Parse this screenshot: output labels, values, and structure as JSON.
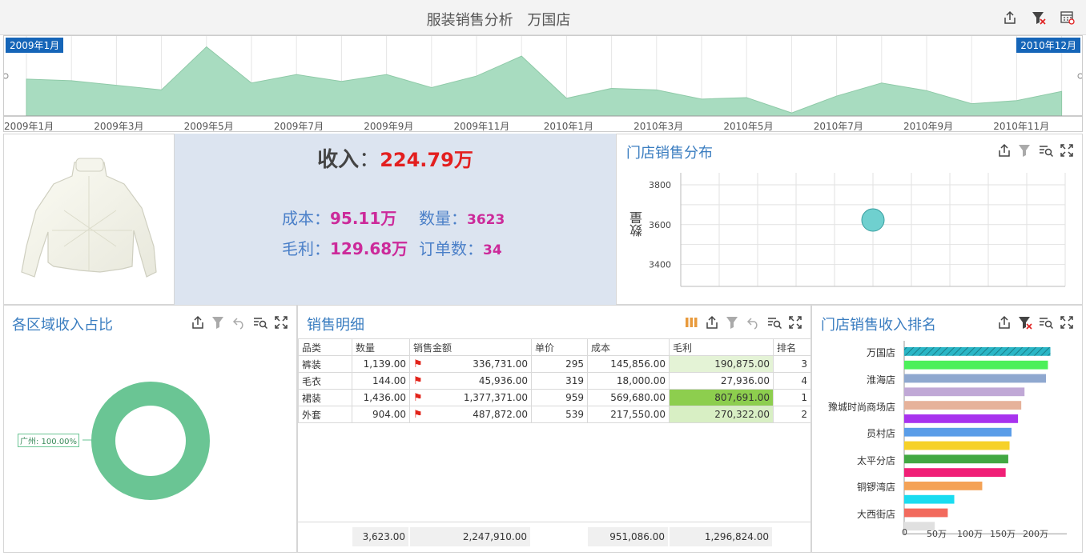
{
  "header": {
    "title": "服装销售分析",
    "store": "万国店"
  },
  "timeline": {
    "start_badge": "2009年1月",
    "end_badge": "2010年12月",
    "labels": [
      "2009年1月",
      "2009年3月",
      "2009年5月",
      "2009年7月",
      "2009年9月",
      "2009年11月",
      "2010年1月",
      "2010年3月",
      "2010年5月",
      "2010年7月",
      "2010年9月",
      "2010年11月"
    ],
    "color": "#a8dcc0"
  },
  "kpi": {
    "revenue_label": "收入",
    "revenue_value": "224.79万",
    "cost_label": "成本",
    "cost_value": "95.11万",
    "qty_label": "数量",
    "qty_value": "3623",
    "profit_label": "毛利",
    "profit_value": "129.68万",
    "orders_label": "订单数",
    "orders_value": "34",
    "separator": "："
  },
  "scatter": {
    "title": "门店销售分布",
    "ylabel": "数量",
    "yticks": [
      "3800",
      "3600",
      "3400"
    ]
  },
  "donut": {
    "title": "各区域收入占比",
    "label": "广州: 100.00%",
    "color": "#6ac594"
  },
  "detail": {
    "title": "销售明细",
    "columns": [
      "品类",
      "数量",
      "销售金额",
      "单价",
      "成本",
      "毛利",
      "排名"
    ],
    "rows": [
      [
        "裤装",
        "1,139.00",
        "336,731.00",
        "295",
        "145,856.00",
        "190,875.00",
        "3"
      ],
      [
        "毛衣",
        "144.00",
        "45,936.00",
        "319",
        "18,000.00",
        "27,936.00",
        "4"
      ],
      [
        "裙装",
        "1,436.00",
        "1,377,371.00",
        "959",
        "569,680.00",
        "807,691.00",
        "1"
      ],
      [
        "外套",
        "904.00",
        "487,872.00",
        "539",
        "217,550.00",
        "270,322.00",
        "2"
      ]
    ],
    "flag_icon": "⚑",
    "totals": [
      "3,623.00",
      "2,247,910.00",
      "951,086.00",
      "1,296,824.00"
    ]
  },
  "ranking": {
    "title": "门店销售收入排名",
    "labels": [
      "万国店",
      "淮海店",
      "豫城时尚商场店",
      "员村店",
      "太平分店",
      "铜锣湾店",
      "大西街店"
    ],
    "xticks": [
      "0",
      "50万",
      "100万",
      "150万",
      "200万"
    ]
  },
  "chart_data": [
    {
      "type": "area",
      "title": "",
      "x": [
        "2009-01",
        "2009-02",
        "2009-03",
        "2009-04",
        "2009-05",
        "2009-06",
        "2009-07",
        "2009-08",
        "2009-09",
        "2009-10",
        "2009-11",
        "2009-12",
        "2010-01",
        "2010-02",
        "2010-03",
        "2010-04",
        "2010-05",
        "2010-06",
        "2010-07",
        "2010-08",
        "2010-09",
        "2010-10",
        "2010-11",
        "2010-12"
      ],
      "series": [
        {
          "values": [
            48,
            46,
            40,
            34,
            90,
            43,
            54,
            45,
            54,
            37,
            52,
            78,
            23,
            36,
            34,
            22,
            24,
            4,
            26,
            43,
            33,
            16,
            20,
            32
          ]
        }
      ],
      "ylim": [
        0,
        100
      ]
    },
    {
      "type": "scatter",
      "title": "门店销售分布",
      "ylabel": "数量",
      "ylim": [
        3290,
        3860
      ],
      "points": [
        {
          "x": 5,
          "y": 3623
        }
      ],
      "xlim": [
        0,
        10
      ]
    },
    {
      "type": "pie",
      "title": "各区域收入占比",
      "slices": [
        {
          "name": "广州",
          "value": 100.0
        }
      ]
    },
    {
      "type": "bar",
      "title": "门店销售收入排名",
      "orientation": "horizontal",
      "xlim": [
        0,
        250
      ],
      "values": [
        224.79,
        221,
        218,
        185,
        180,
        175,
        165,
        162,
        160,
        156,
        120,
        77,
        67,
        47
      ],
      "colors": [
        "#2ab6c6",
        "#4cf05a",
        "#8fa8cf",
        "#c0a8d6",
        "#e6b29a",
        "#a833ee",
        "#5a9de8",
        "#f6d128",
        "#42a842",
        "#f01f76",
        "#f4a256",
        "#1adcf0",
        "#f26a5d",
        "#e0e0e0"
      ]
    }
  ]
}
